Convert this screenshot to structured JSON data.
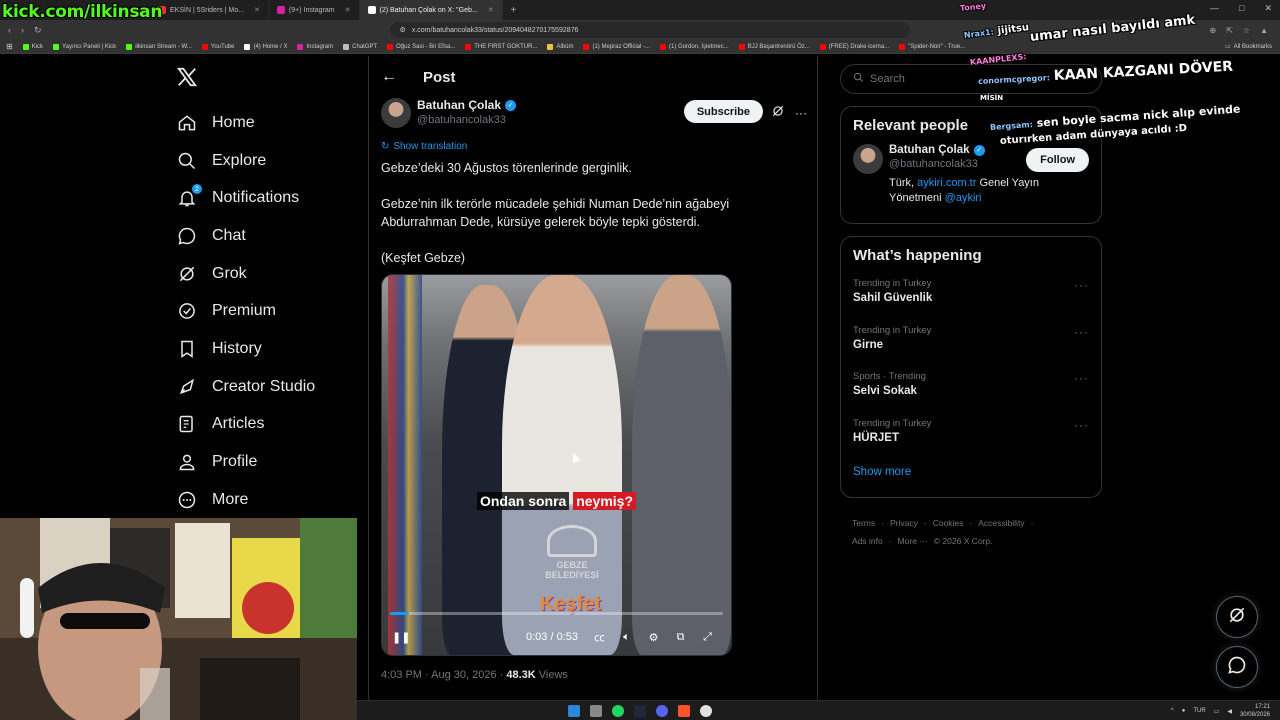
{
  "overlay": {
    "streamer_url": "kick.com/ilkinsan",
    "chat": [
      {
        "user": "Toney",
        "text": ""
      },
      {
        "user": "Nrax1:",
        "text": "jijitsu"
      },
      {
        "user": "",
        "text": "umar nasıl bayıldı amk"
      },
      {
        "user": "KAANPLEXS:",
        "text": "umar nasıl bayıldı amk"
      },
      {
        "user": "conormcgregor:",
        "text": "KAAN KAZGANI DÖVER"
      },
      {
        "user": "",
        "text": "MİSİN"
      },
      {
        "user": "Bergsam:",
        "text": "sen boyle sacma nick alıp evinde"
      },
      {
        "user": "",
        "text": "oturırken adam dünyaya acıldı :D"
      }
    ]
  },
  "browser": {
    "tabs": [
      {
        "label": "EKSİN | 5Sriders | Mo...",
        "color": "#e9362b"
      },
      {
        "label": "(9+) Instagram",
        "color": "#d6249f"
      },
      {
        "label": "(2) Batuhan Çolak on X: \"Geb...",
        "color": "#ffffff",
        "active": true
      }
    ],
    "url": "x.com/batuhancolak33/status/2094048270175592876",
    "bookmarks": [
      {
        "label": "Kick",
        "color": "#53fc18"
      },
      {
        "label": "Yayıncı Paneli | Kick",
        "color": "#53fc18"
      },
      {
        "label": "ilkinsan Stream - W...",
        "color": "#53fc18"
      },
      {
        "label": "YouTube",
        "color": "#ff0000"
      },
      {
        "label": "(4) Home / X",
        "color": "#ffffff"
      },
      {
        "label": "Instagram",
        "color": "#d6249f"
      },
      {
        "label": "ChatGPT",
        "color": "#bbbbbb"
      },
      {
        "label": "Oğuz Sasi - Bir Efsa...",
        "color": "#ff0000"
      },
      {
        "label": "THE FIRST GOKTUR...",
        "color": "#ff0000"
      },
      {
        "label": "Albüm",
        "color": "#f0c040"
      },
      {
        "label": "(1) Mepraz Official -...",
        "color": "#ff0000"
      },
      {
        "label": "(1) Gordon, İşletmec...",
        "color": "#ff0000"
      },
      {
        "label": "BJJ Başantrenörü Öz...",
        "color": "#ff0000"
      },
      {
        "label": "(FREE) Drake icema...",
        "color": "#ff0000"
      },
      {
        "label": "\"Spider-Noir\" - True...",
        "color": "#ff0000"
      }
    ],
    "all_bookmarks": "All Bookmarks"
  },
  "nav": {
    "items": [
      {
        "label": "Home",
        "icon": "home-icon"
      },
      {
        "label": "Explore",
        "icon": "search-icon"
      },
      {
        "label": "Notifications",
        "icon": "bell-icon",
        "badge": "2"
      },
      {
        "label": "Chat",
        "icon": "chat-icon"
      },
      {
        "label": "Grok",
        "icon": "grok-icon"
      },
      {
        "label": "Premium",
        "icon": "premium-icon"
      },
      {
        "label": "History",
        "icon": "bookmark-icon"
      },
      {
        "label": "Creator Studio",
        "icon": "rocket-icon"
      },
      {
        "label": "Articles",
        "icon": "articles-icon"
      },
      {
        "label": "Profile",
        "icon": "profile-icon"
      },
      {
        "label": "More",
        "icon": "more-icon"
      }
    ]
  },
  "post": {
    "header_title": "Post",
    "author_name": "Batuhan Çolak",
    "author_handle": "@batuhancolak33",
    "subscribe_label": "Subscribe",
    "show_translation": "Show translation",
    "text": [
      "Gebze’deki 30 Ağustos törenlerinde gerginlik.",
      "Gebze’nin ilk terörle mücadele şehidi Numan Dede’nin ağabeyi Abdurrahman Dede, kürsüye gelerek böyle tepki gösterdi.",
      "(Keşfet Gebze)"
    ],
    "video": {
      "caption_prefix": "Ondan sonra",
      "caption_highlight": "neymiş?",
      "logo_text": "GEBZE BELEDİYESİ",
      "watermark": "Keşfet",
      "time": "0:03 / 0:53",
      "progress": 0.057
    },
    "timestamp": "4:03 PM · Aug 30, 2026 · ",
    "views_count": "48.3K",
    "views_label": " Views"
  },
  "sidebar": {
    "search_placeholder": "Search",
    "relevant": {
      "title": "Relevant people",
      "name": "Batuhan Çolak",
      "handle": "@batuhancolak33",
      "bio_prefix": "Türk, ",
      "bio_link1": "aykiri.com.tr",
      "bio_middle": " Genel Yayın Yönetmeni ",
      "bio_link2": "@aykiri",
      "follow_label": "Follow"
    },
    "happening": {
      "title": "What’s happening",
      "trends": [
        {
          "context": "Trending in Turkey",
          "name": "Sahil Güvenlik"
        },
        {
          "context": "Trending in Turkey",
          "name": "Girne"
        },
        {
          "context": "Sports · Trending",
          "name": "Selvi Sokak"
        },
        {
          "context": "Trending in Turkey",
          "name": "HÜRJET"
        }
      ],
      "show_more": "Show more"
    },
    "footer": [
      "Terms",
      "·",
      "Privacy",
      "·",
      "Cookies",
      "·",
      "Accessibility",
      "·",
      "Ads info",
      "·",
      "More ···",
      "© 2026 X Corp."
    ]
  },
  "taskbar": {
    "lang": "TUR",
    "time": "17:21",
    "date": "30/08/2026"
  }
}
